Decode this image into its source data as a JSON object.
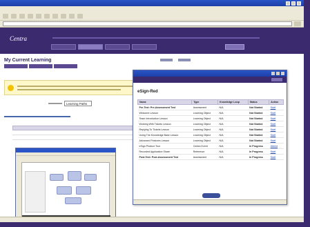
{
  "browser": {
    "title": "",
    "menu": [
      "",
      "",
      "",
      "",
      "",
      ""
    ]
  },
  "app": {
    "logo_text": "Centra"
  },
  "page": {
    "title": "My Current Learning",
    "filter_value": "Learning Paths"
  },
  "popup": {
    "title": "eSign-Red",
    "columns": [
      "Name",
      "Type",
      "Knowledge Loop",
      "Status",
      "Action"
    ],
    "rows": [
      {
        "name": "Pre-Test: Pre-Assessment Test",
        "type": "Assessment",
        "kl": "N/A",
        "status": "Not Started",
        "action": "Start",
        "bold": true
      },
      {
        "name": "Welcome Lesson",
        "type": "Learning Object",
        "kl": "N/A",
        "status": "Not Started",
        "action": "Start",
        "bold": false
      },
      {
        "name": "Team Introduction Lesson",
        "type": "Learning Object",
        "kl": "N/A",
        "status": "Not Started",
        "action": "Start",
        "bold": false
      },
      {
        "name": "Working With Tickets Lesson",
        "type": "Learning Object",
        "kl": "N/A",
        "status": "Not Started",
        "action": "Start",
        "bold": false
      },
      {
        "name": "Replying To Tickets Lesson",
        "type": "Learning Object",
        "kl": "N/A",
        "status": "Not Started",
        "action": "Start",
        "bold": false
      },
      {
        "name": "Using The Knowledge Base Lesson",
        "type": "Learning Object",
        "kl": "N/A",
        "status": "Not Started",
        "action": "Start",
        "bold": false
      },
      {
        "name": "Advanced Features Lesson",
        "type": "Learning Object",
        "kl": "N/A",
        "status": "Not Started",
        "action": "Start",
        "bold": false
      },
      {
        "name": "eSign Product Tour",
        "type": "Centra Event",
        "kl": "N/A",
        "status": "In Progress",
        "action": "Attend",
        "bold": false
      },
      {
        "name": "Recorded Application Share",
        "type": "Reference",
        "kl": "N/A",
        "status": "In Progress",
        "action": "Start",
        "bold": false
      },
      {
        "name": "Post-Test: Post-Assessment Test",
        "type": "Assessment",
        "kl": "N/A",
        "status": "In Progress",
        "action": "Start",
        "bold": true
      }
    ]
  }
}
